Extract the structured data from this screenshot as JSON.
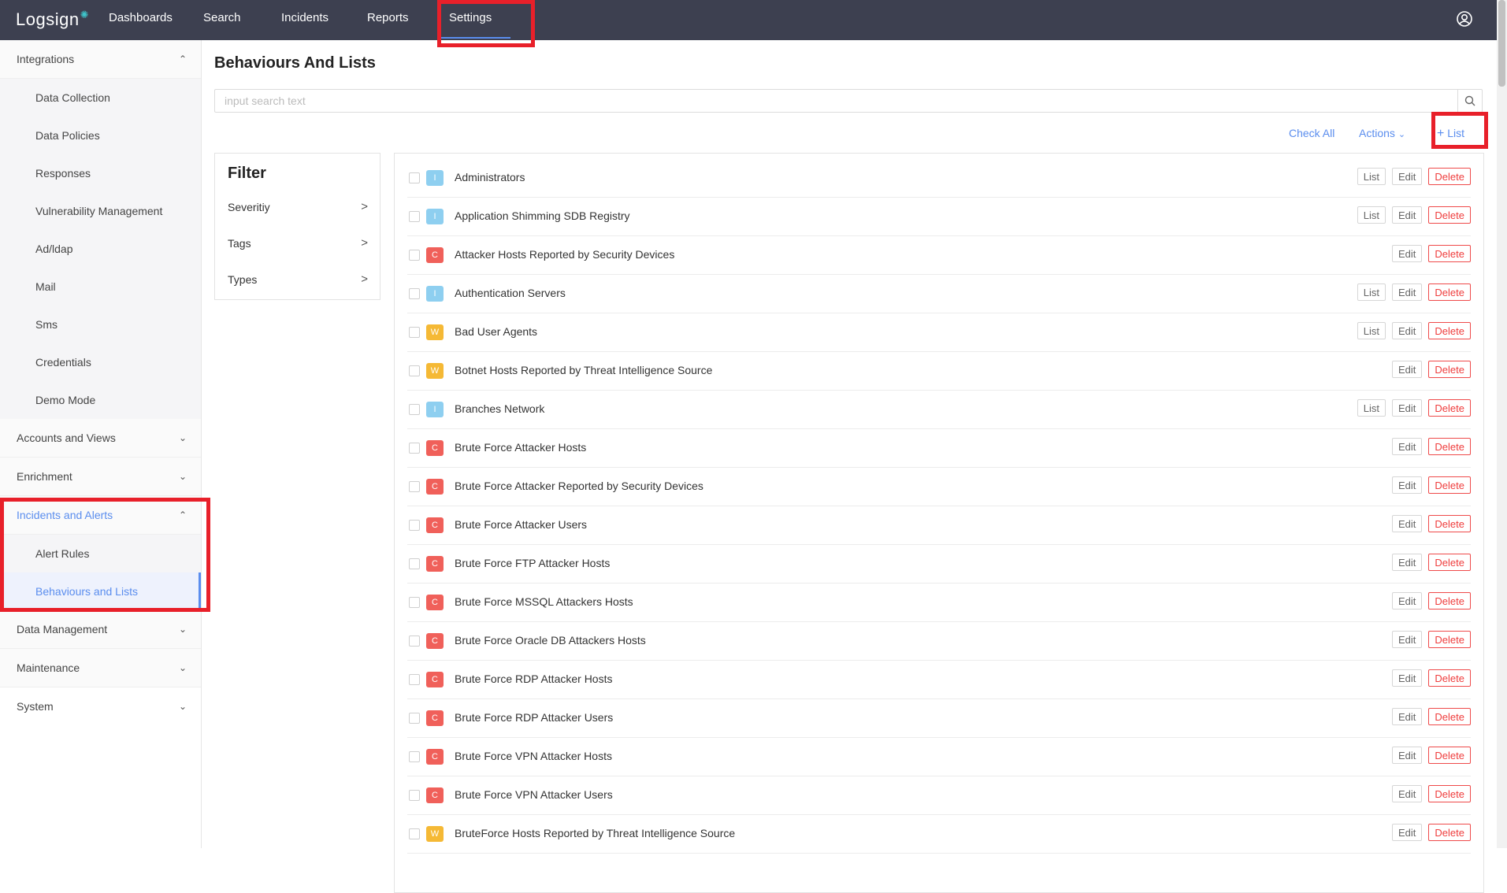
{
  "nav": {
    "logo": "Logsign",
    "items": [
      "Dashboards",
      "Search",
      "Incidents",
      "Reports",
      "Settings"
    ],
    "active": "Settings"
  },
  "sidebar": {
    "groups": [
      {
        "label": "Integrations",
        "expanded": true,
        "items": [
          "Data Collection",
          "Data Policies",
          "Responses",
          "Vulnerability Management",
          "Ad/ldap",
          "Mail",
          "Sms",
          "Credentials",
          "Demo Mode"
        ]
      },
      {
        "label": "Accounts and Views",
        "expanded": false
      },
      {
        "label": "Enrichment",
        "expanded": false
      },
      {
        "label": "Incidents and Alerts",
        "expanded": true,
        "items": [
          "Alert Rules",
          "Behaviours and Lists"
        ],
        "active_item": "Behaviours and Lists"
      },
      {
        "label": "Data Management",
        "expanded": false
      },
      {
        "label": "Maintenance",
        "expanded": false
      },
      {
        "label": "System",
        "expanded": false
      }
    ]
  },
  "main": {
    "title": "Behaviours And Lists",
    "search": {
      "placeholder": "input search text",
      "value": ""
    },
    "toolbar": {
      "check_all": "Check All",
      "actions": "Actions",
      "add_list": "List"
    },
    "filter": {
      "title": "Filter",
      "items": [
        "Severitiy",
        "Tags",
        "Types"
      ]
    },
    "buttons": {
      "list": "List",
      "edit": "Edit",
      "delete": "Delete"
    },
    "rows": [
      {
        "badge": "I",
        "name": "Administrators",
        "has_list": true
      },
      {
        "badge": "I",
        "name": "Application Shimming SDB Registry",
        "has_list": true
      },
      {
        "badge": "C",
        "name": "Attacker Hosts Reported by Security Devices",
        "has_list": false
      },
      {
        "badge": "I",
        "name": "Authentication Servers",
        "has_list": true
      },
      {
        "badge": "W",
        "name": "Bad User Agents",
        "has_list": true
      },
      {
        "badge": "W",
        "name": "Botnet Hosts Reported by Threat Intelligence Source",
        "has_list": false
      },
      {
        "badge": "I",
        "name": "Branches Network",
        "has_list": true
      },
      {
        "badge": "C",
        "name": "Brute Force Attacker Hosts",
        "has_list": false
      },
      {
        "badge": "C",
        "name": "Brute Force Attacker Reported by Security Devices",
        "has_list": false
      },
      {
        "badge": "C",
        "name": "Brute Force Attacker Users",
        "has_list": false
      },
      {
        "badge": "C",
        "name": "Brute Force FTP Attacker Hosts",
        "has_list": false
      },
      {
        "badge": "C",
        "name": "Brute Force MSSQL Attackers Hosts",
        "has_list": false
      },
      {
        "badge": "C",
        "name": "Brute Force Oracle DB Attackers Hosts",
        "has_list": false
      },
      {
        "badge": "C",
        "name": "Brute Force RDP Attacker Hosts",
        "has_list": false
      },
      {
        "badge": "C",
        "name": "Brute Force RDP Attacker Users",
        "has_list": false
      },
      {
        "badge": "C",
        "name": "Brute Force VPN Attacker Hosts",
        "has_list": false
      },
      {
        "badge": "C",
        "name": "Brute Force VPN Attacker Users",
        "has_list": false
      },
      {
        "badge": "W",
        "name": "BruteForce Hosts Reported by Threat Intelligence Source",
        "has_list": false
      }
    ]
  },
  "colors": {
    "accent": "#5a8dee",
    "highlight": "#e8202a",
    "badge_I": "#8ecff0",
    "badge_C": "#f0605a",
    "badge_W": "#f5b935",
    "nav_bg": "#3d4050"
  }
}
